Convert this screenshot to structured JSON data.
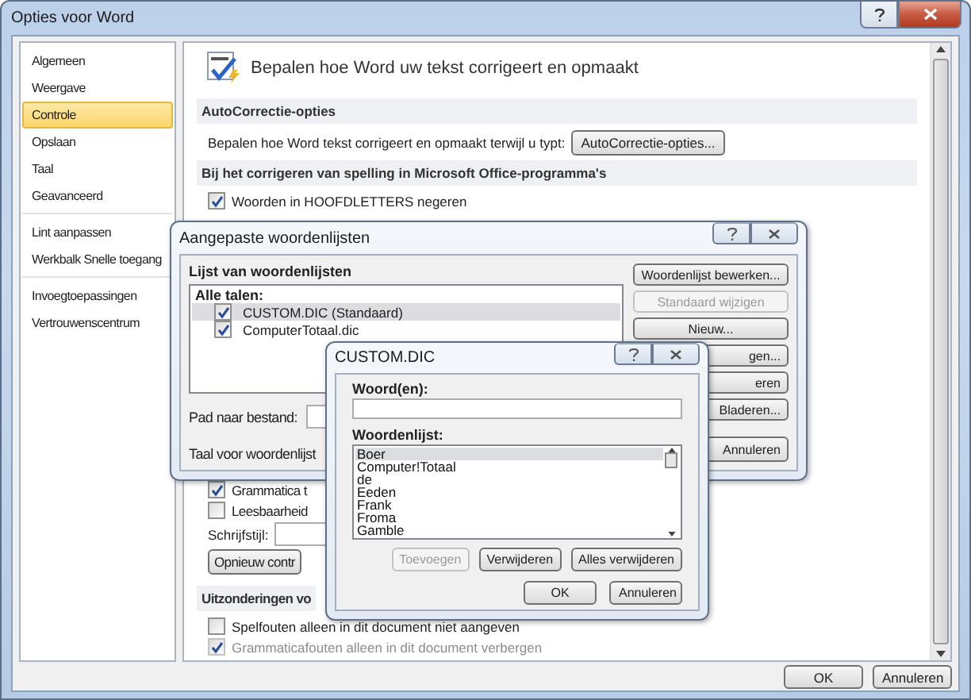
{
  "window": {
    "title": "Opties voor Word"
  },
  "sidebar": {
    "groups": [
      [
        {
          "label": "Algemeen",
          "selected": false
        },
        {
          "label": "Weergave",
          "selected": false
        },
        {
          "label": "Controle",
          "selected": true
        },
        {
          "label": "Opslaan",
          "selected": false
        },
        {
          "label": "Taal",
          "selected": false
        },
        {
          "label": "Geavanceerd",
          "selected": false
        }
      ],
      [
        {
          "label": "Lint aanpassen",
          "selected": false
        },
        {
          "label": "Werkbalk Snelle toegang",
          "selected": false
        }
      ],
      [
        {
          "label": "Invoegtoepassingen",
          "selected": false
        },
        {
          "label": "Vertrouwenscentrum",
          "selected": false
        }
      ]
    ]
  },
  "heading": "Bepalen hoe Word uw tekst corrigeert en opmaakt",
  "autocorrect": {
    "header": "AutoCorrectie-opties",
    "text": "Bepalen hoe Word tekst corrigeert en opmaakt terwijl u typt:",
    "button": "AutoCorrectie-opties..."
  },
  "spelling": {
    "header": "Bij het corrigeren van spelling in Microsoft Office-programma's",
    "options": [
      {
        "label": "Woorden in HOOFDLETTERS negeren",
        "checked": true
      }
    ]
  },
  "grammar": {
    "options": [
      {
        "label": "Grammatica t",
        "checked": true
      },
      {
        "label": "Leesbaarheid",
        "checked": false
      }
    ],
    "style_label": "Schrijfstijl:",
    "recheck_button": "Opnieuw contr"
  },
  "exceptions": {
    "header": "Uitzonderingen vo",
    "options": [
      {
        "label": "Spelfouten alleen in dit document niet aangeven",
        "checked": false,
        "disabled": false
      },
      {
        "label": "Grammaticafouten alleen in dit document verbergen",
        "checked": true,
        "disabled": true
      }
    ]
  },
  "footer_buttons": [
    "OK",
    "Annuleren"
  ],
  "dictionaries_dialog": {
    "title": "Aangepaste woordenlijsten",
    "list_label": "Lijst van woordenlijsten",
    "group": "Alle talen:",
    "items": [
      {
        "name": "CUSTOM.DIC (Standaard)",
        "checked": true,
        "selected": true
      },
      {
        "name": "ComputerTotaal.dic",
        "checked": true,
        "selected": false
      }
    ],
    "path_label": "Pad naar bestand:",
    "language_label": "Taal voor woordenlijst",
    "buttons": [
      {
        "label": "Woordenlijst bewerken...",
        "disabled": false
      },
      {
        "label": "Standaard wijzigen",
        "disabled": true
      },
      {
        "label": "Nieuw...",
        "disabled": false
      }
    ],
    "partial_buttons": [
      "gen...",
      "eren",
      "Bladeren..."
    ],
    "cancel_button": "Annuleren"
  },
  "custom_dialog": {
    "title": "CUSTOM.DIC",
    "word_label": "Woord(en):",
    "list_label": "Woordenlijst:",
    "words": [
      {
        "text": "Boer",
        "selected": true
      },
      {
        "text": "Computer!Totaal",
        "selected": false
      },
      {
        "text": "de",
        "selected": false
      },
      {
        "text": "Eeden",
        "selected": false
      },
      {
        "text": "Frank",
        "selected": false
      },
      {
        "text": "Froma",
        "selected": false
      },
      {
        "text": "Gamble",
        "selected": false
      }
    ],
    "buttons": [
      {
        "label": "Toevoegen",
        "disabled": true
      },
      {
        "label": "Verwijderen",
        "disabled": false
      },
      {
        "label": "Alles verwijderen",
        "disabled": false
      }
    ],
    "footer_buttons": [
      "OK",
      "Annuleren"
    ]
  }
}
